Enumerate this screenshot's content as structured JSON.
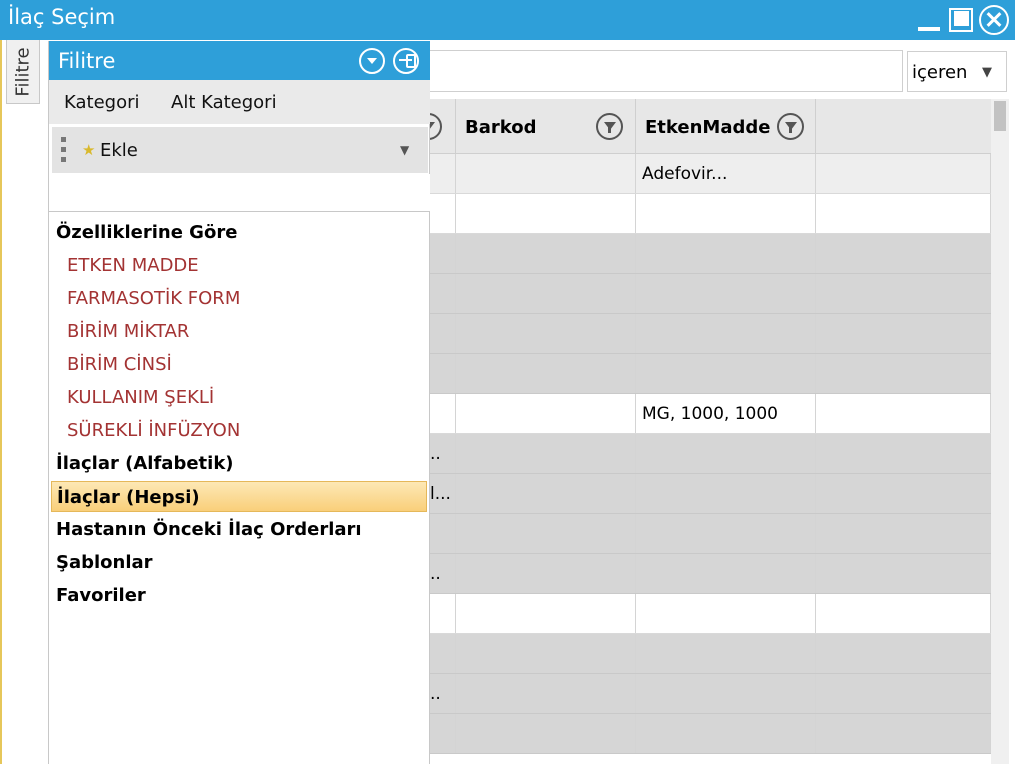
{
  "window": {
    "title": "İlaç Seçim"
  },
  "side_tab": {
    "label": "Filitre"
  },
  "search": {
    "value": "",
    "match_mode": "içeren"
  },
  "grid": {
    "columns": [
      {
        "label": ""
      },
      {
        "label": "Barkod"
      },
      {
        "label": "EtkenMadde"
      },
      {
        "label": ""
      }
    ],
    "filter_row": [
      "",
      "",
      "Adefovir...",
      ""
    ],
    "rows": [
      {
        "cells": [
          "",
          "",
          "",
          ""
        ],
        "shade": "white"
      },
      {
        "cells": [
          "",
          "",
          "",
          ""
        ],
        "shade": "gray"
      },
      {
        "cells": [
          "",
          "",
          "",
          ""
        ],
        "shade": "gray"
      },
      {
        "cells": [
          "",
          "",
          "",
          ""
        ],
        "shade": "gray"
      },
      {
        "cells": [
          "",
          "",
          "",
          ""
        ],
        "shade": "gray"
      },
      {
        "cells": [
          "",
          "",
          "MG, 1000, 1000",
          ""
        ],
        "shade": "white"
      },
      {
        "cells": [
          "..",
          "",
          "",
          ""
        ],
        "shade": "gray"
      },
      {
        "cells": [
          "l...",
          "",
          "",
          ""
        ],
        "shade": "gray"
      },
      {
        "cells": [
          "",
          "",
          "",
          ""
        ],
        "shade": "gray"
      },
      {
        "cells": [
          "..",
          "",
          "",
          ""
        ],
        "shade": "gray"
      },
      {
        "cells": [
          "",
          "",
          "",
          ""
        ],
        "shade": "white"
      },
      {
        "cells": [
          "",
          "",
          "",
          ""
        ],
        "shade": "gray"
      },
      {
        "cells": [
          "..",
          "",
          "",
          ""
        ],
        "shade": "gray"
      },
      {
        "cells": [
          "",
          "",
          "",
          ""
        ],
        "shade": "gray"
      }
    ]
  },
  "filter_panel": {
    "title": "Filitre",
    "tabs": [
      "Kategori",
      "Alt Kategori"
    ],
    "toolbar": {
      "add_label": "Ekle"
    },
    "tree": [
      {
        "label": "Özelliklerine Göre",
        "type": "group",
        "selected": false
      },
      {
        "label": "ETKEN MADDE",
        "type": "sub",
        "selected": false
      },
      {
        "label": "FARMASOTİK FORM",
        "type": "sub",
        "selected": false
      },
      {
        "label": "BİRİM MİKTAR",
        "type": "sub",
        "selected": false
      },
      {
        "label": "BİRİM CİNSİ",
        "type": "sub",
        "selected": false
      },
      {
        "label": "KULLANIM ŞEKLİ",
        "type": "sub",
        "selected": false
      },
      {
        "label": "SÜREKLİ İNFÜZYON",
        "type": "sub",
        "selected": false
      },
      {
        "label": "İlaçlar (Alfabetik)",
        "type": "group",
        "selected": false
      },
      {
        "label": "İlaçlar (Hepsi)",
        "type": "group",
        "selected": true
      },
      {
        "label": "Hastanın Önceki İlaç Orderları",
        "type": "group",
        "selected": false
      },
      {
        "label": "Şablonlar",
        "type": "group",
        "selected": false
      },
      {
        "label": "Favoriler",
        "type": "group",
        "selected": false
      }
    ]
  }
}
